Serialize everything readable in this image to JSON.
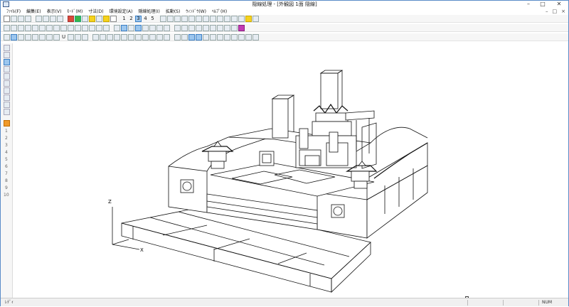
{
  "window": {
    "title": "隠線処理 - [外観図  1面   隠線]",
    "minimize": "–",
    "maximize": "□",
    "close": "✕"
  },
  "menu": {
    "items": [
      "ﾌｧｲﾙ(F)",
      "編集(E)",
      "表示(V)",
      "ﾓｰﾄﾞ(M)",
      "寸法(D)",
      "環境設定(A)",
      "隠線処理(I)",
      "拡動(S)",
      "ｳｨﾝﾄﾞｳ(W)",
      "ﾍﾙﾌﾟ(H)"
    ],
    "mdi_controls": [
      "–",
      "□",
      "×"
    ]
  },
  "toolbar1": {
    "numbers": [
      "1",
      "2",
      "3",
      "4",
      "5"
    ],
    "selected_number": "3"
  },
  "toolbar3": {
    "labels": [
      "U"
    ]
  },
  "axes": {
    "z_label": "Z",
    "x_label": "X"
  },
  "left_numbers": [
    "1",
    "2",
    "3",
    "4",
    "5",
    "6",
    "7",
    "8",
    "9",
    "10"
  ],
  "status": {
    "left": "ﾚﾃﾞｨ",
    "num": "NUM"
  },
  "icons": {
    "app": "app-icon",
    "cursor": "cursor-icon"
  }
}
